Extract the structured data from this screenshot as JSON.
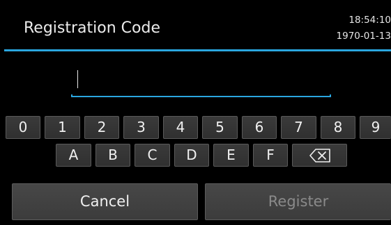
{
  "header": {
    "title": "Registration Code",
    "time": "18:54:10",
    "date": "1970-01-13"
  },
  "input": {
    "value": ""
  },
  "keypad": {
    "digits": [
      "0",
      "1",
      "2",
      "3",
      "4",
      "5",
      "6",
      "7",
      "8",
      "9"
    ],
    "letters": [
      "A",
      "B",
      "C",
      "D",
      "E",
      "F"
    ],
    "backspace_icon": "backspace-icon"
  },
  "actions": {
    "cancel_label": "Cancel",
    "register_label": "Register"
  },
  "colors": {
    "accent": "#2aa6df",
    "background": "#000000",
    "key": "#333333",
    "disabled_text": "#8a8a8a"
  }
}
